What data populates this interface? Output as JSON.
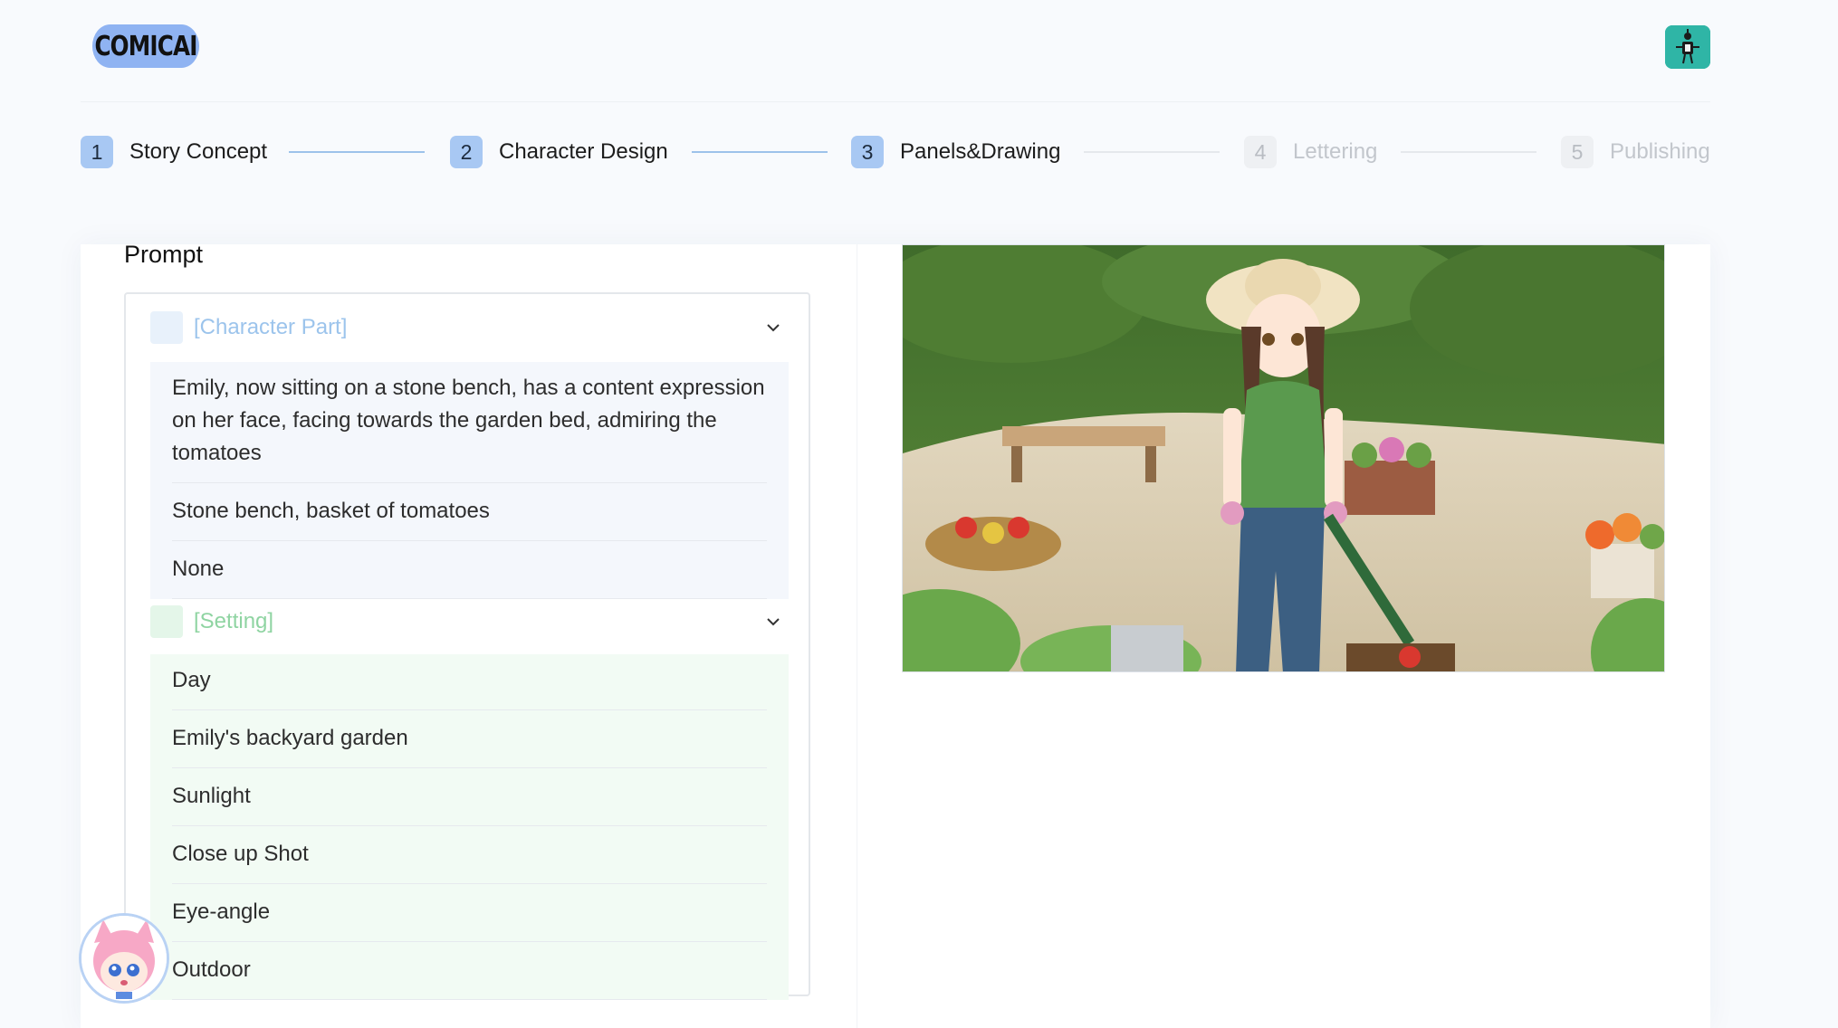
{
  "app": {
    "logo_text": "COMICAI"
  },
  "steps": [
    {
      "num": "1",
      "label": "Story Concept",
      "active": true
    },
    {
      "num": "2",
      "label": "Character Design",
      "active": true
    },
    {
      "num": "3",
      "label": "Panels&Drawing",
      "active": true
    },
    {
      "num": "4",
      "label": "Lettering",
      "active": false
    },
    {
      "num": "5",
      "label": "Publishing",
      "active": false
    }
  ],
  "prompt": {
    "title": "Prompt",
    "character": {
      "title": "[Character Part]",
      "color": "#9cc4ec",
      "swatch": "#e8f1fb",
      "bg": "#f4f7fc",
      "items": [
        "Emily, now sitting on a stone bench, has a content expression on her face, facing towards the garden bed, admiring the tomatoes",
        "Stone bench, basket of tomatoes",
        "None"
      ]
    },
    "setting": {
      "title": "[Setting]",
      "color": "#8fd4a2",
      "swatch": "#e4f6e9",
      "bg": "#f2fbf4",
      "items": [
        "Day",
        "Emily's backyard garden",
        "Sunlight",
        "Close up Shot",
        "Eye-angle",
        "Outdoor"
      ]
    }
  },
  "icons": {
    "chevron": "chevron-down-icon",
    "user": "robot-avatar-icon",
    "assistant": "mascot-avatar-icon"
  }
}
